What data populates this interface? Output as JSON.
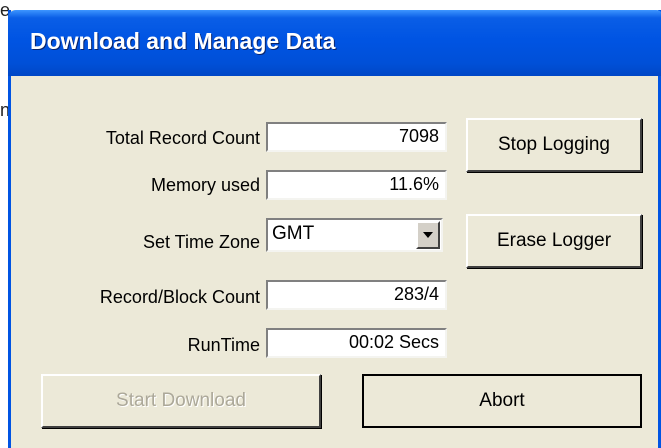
{
  "background": {
    "fragment_top": "e",
    "fragment_mid": "n"
  },
  "window": {
    "title": "Download and Manage Data"
  },
  "fields": {
    "total_record_count": {
      "label": "Total Record Count",
      "value": "7098"
    },
    "memory_used": {
      "label": "Memory used",
      "value": "11.6%"
    },
    "time_zone": {
      "label": "Set Time Zone",
      "value": "GMT"
    },
    "record_block_count": {
      "label": "Record/Block Count",
      "value": "283/4"
    },
    "runtime": {
      "label": "RunTime",
      "value": "00:02 Secs"
    }
  },
  "buttons": {
    "stop_logging": "Stop Logging",
    "erase_logger": "Erase Logger",
    "start_download": "Start Download",
    "abort": "Abort"
  },
  "colors": {
    "titlebar": "#0054e3",
    "dialog_bg": "#ece9d8",
    "disabled_text": "#aca899"
  }
}
